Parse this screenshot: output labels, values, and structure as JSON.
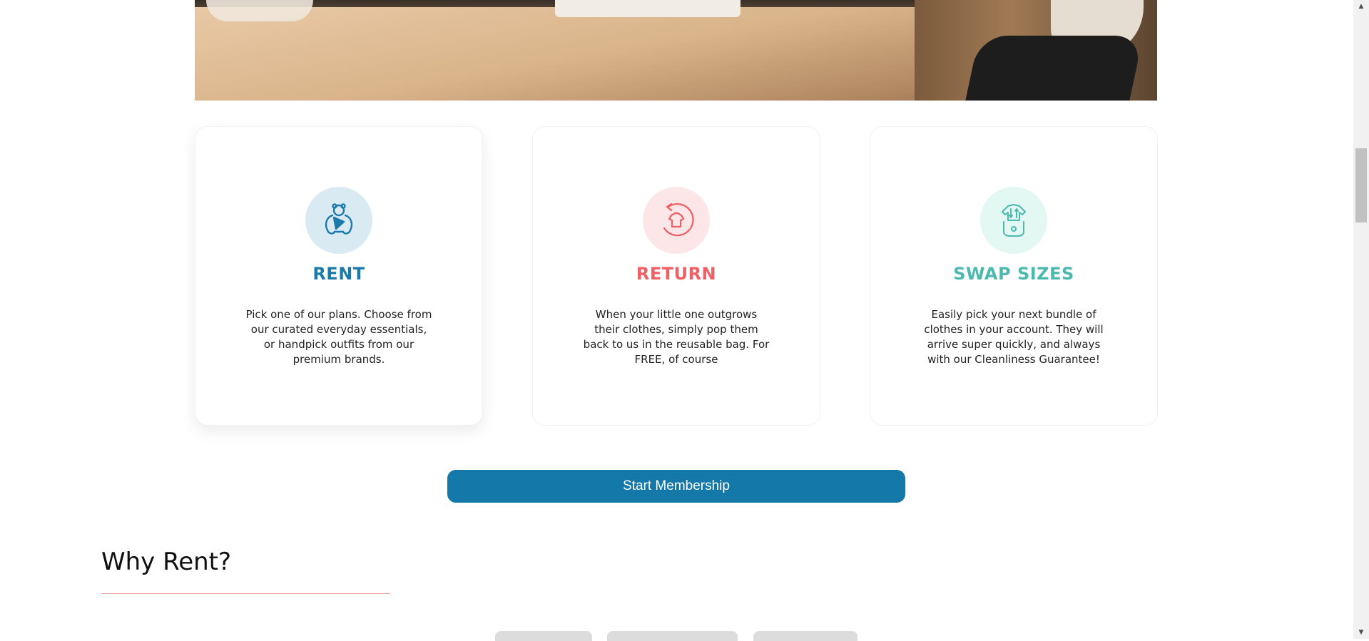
{
  "steps": [
    {
      "title": "RENT",
      "text": "Pick one of our plans. Choose from our curated everyday essentials, or handpick outfits from our premium brands.",
      "icon": "baby-bib-icon",
      "color": "#1a7bab",
      "icon_bg": "#d9eaf3"
    },
    {
      "title": "RETURN",
      "text": "When your little one outgrows their clothes, simply pop them back to us in the reusable bag. For FREE, of course",
      "icon": "return-shirt-icon",
      "color": "#ef5f63",
      "icon_bg": "#fde6e7"
    },
    {
      "title": "SWAP SIZES",
      "text": "Easily pick your next bundle of clothes in your account. They will arrive super quickly, and always with our Cleanliness Guarantee!",
      "icon": "swap-sizes-icon",
      "color": "#4bb9ad",
      "icon_bg": "#e3f7f3"
    }
  ],
  "cta": {
    "label": "Start Membership",
    "color": "#1479a9"
  },
  "why_section": {
    "title": "Why Rent?"
  }
}
